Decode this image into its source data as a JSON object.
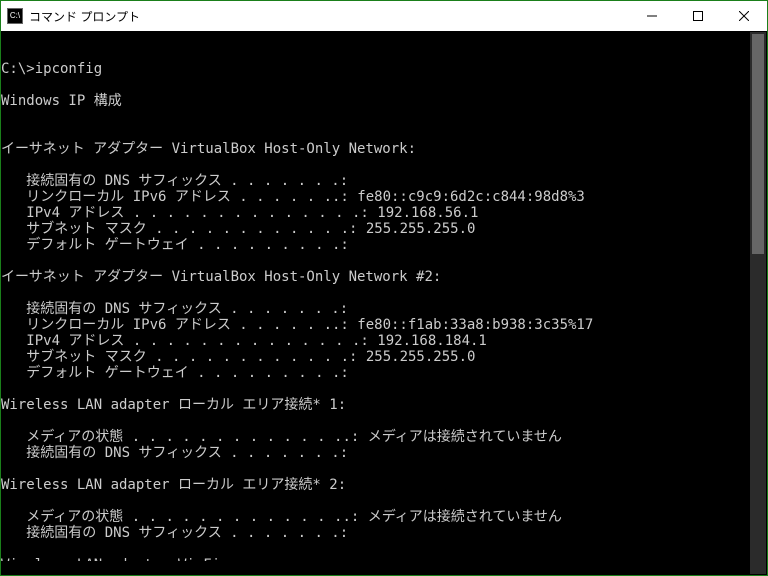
{
  "window": {
    "title": "コマンド プロンプト",
    "icon_label": "C:\\"
  },
  "prompt": {
    "cwd": "C:\\>",
    "command": "ipconfig"
  },
  "output": {
    "header": "Windows IP 構成",
    "adapters": [
      {
        "title": "イーサネット アダプター VirtualBox Host-Only Network:",
        "fields": [
          {
            "label": "接続固有の DNS サフィックス",
            "value": ""
          },
          {
            "label": "リンクローカル IPv6 アドレス",
            "value": "fe80::c9c9:6d2c:c844:98d8%3"
          },
          {
            "label": "IPv4 アドレス",
            "value": "192.168.56.1"
          },
          {
            "label": "サブネット マスク",
            "value": "255.255.255.0"
          },
          {
            "label": "デフォルト ゲートウェイ",
            "value": ""
          }
        ]
      },
      {
        "title": "イーサネット アダプター VirtualBox Host-Only Network #2:",
        "fields": [
          {
            "label": "接続固有の DNS サフィックス",
            "value": ""
          },
          {
            "label": "リンクローカル IPv6 アドレス",
            "value": "fe80::f1ab:33a8:b938:3c35%17"
          },
          {
            "label": "IPv4 アドレス",
            "value": "192.168.184.1"
          },
          {
            "label": "サブネット マスク",
            "value": "255.255.255.0"
          },
          {
            "label": "デフォルト ゲートウェイ",
            "value": ""
          }
        ]
      },
      {
        "title": "Wireless LAN adapter ローカル エリア接続* 1:",
        "fields": [
          {
            "label": "メディアの状態",
            "value": "メディアは接続されていません"
          },
          {
            "label": "接続固有の DNS サフィックス",
            "value": ""
          }
        ]
      },
      {
        "title": "Wireless LAN adapter ローカル エリア接続* 2:",
        "fields": [
          {
            "label": "メディアの状態",
            "value": "メディアは接続されていません"
          },
          {
            "label": "接続固有の DNS サフィックス",
            "value": ""
          }
        ]
      },
      {
        "title": "Wireless LAN adapter Wi-Fi:",
        "fields": []
      }
    ]
  },
  "layout": {
    "indent": "   ",
    "label_col_width": 42
  }
}
